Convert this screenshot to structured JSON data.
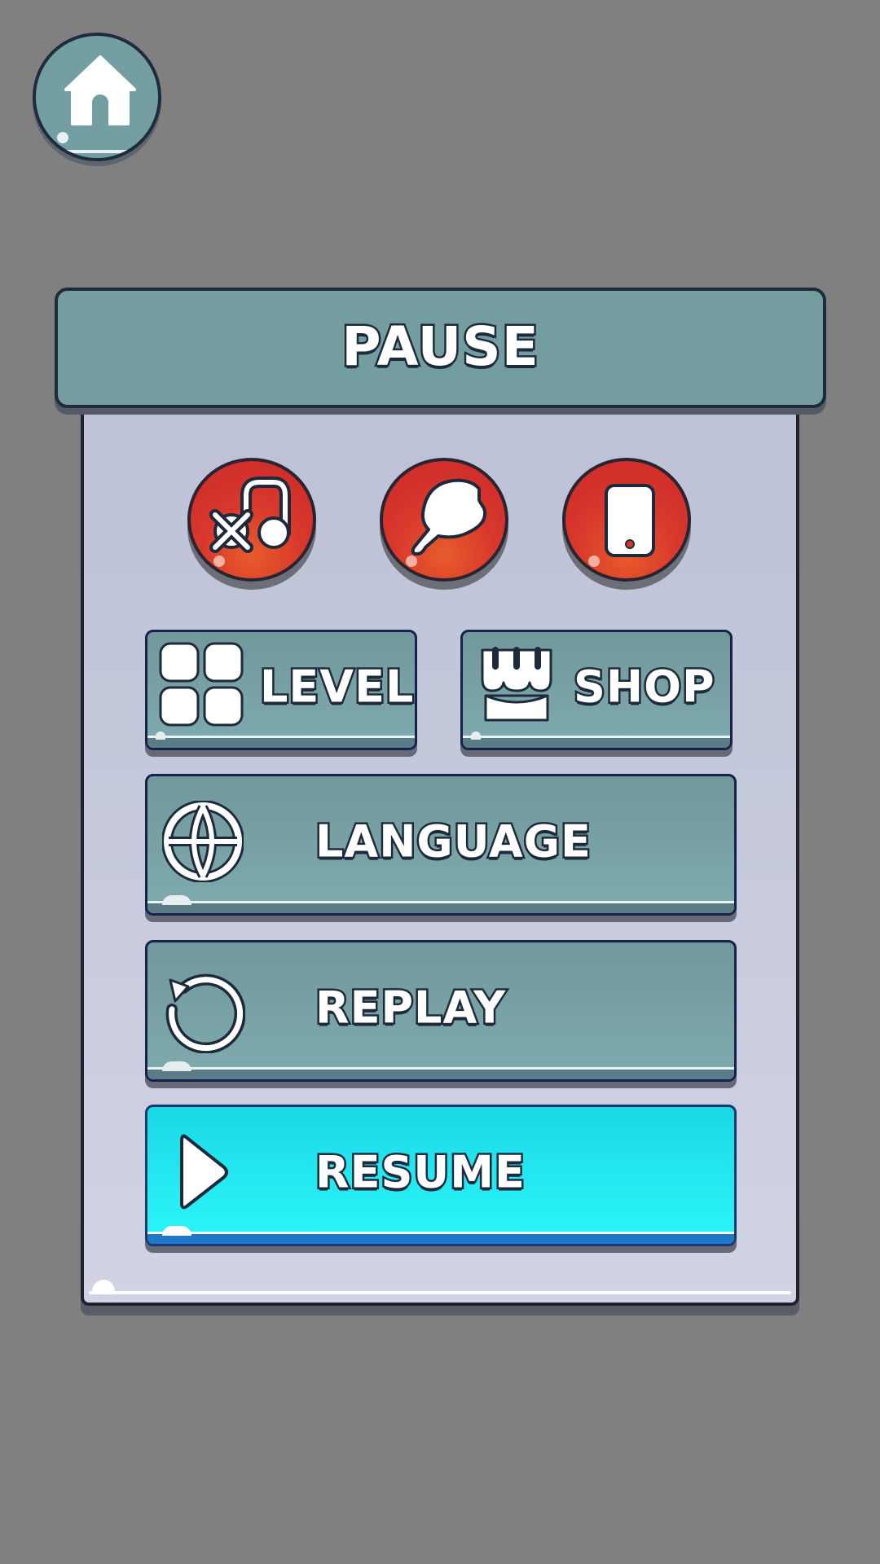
{
  "home": {
    "icon": "home-icon"
  },
  "panel": {
    "title": "PAUSE"
  },
  "toggles": [
    {
      "name": "music-off-toggle",
      "icon": "music-muted-icon"
    },
    {
      "name": "sound-off-toggle",
      "icon": "speaker-muted-icon"
    },
    {
      "name": "vibration-toggle",
      "icon": "phone-icon"
    }
  ],
  "buttons": {
    "level": {
      "label": "LEVEL",
      "icon": "grid-icon"
    },
    "shop": {
      "label": "SHOP",
      "icon": "shop-icon"
    },
    "language": {
      "label": "LANGUAGE",
      "icon": "globe-icon"
    },
    "replay": {
      "label": "REPLAY",
      "icon": "replay-icon"
    },
    "resume": {
      "label": "RESUME",
      "icon": "play-icon"
    }
  },
  "colors": {
    "background": "#808080",
    "teal": "#749da0",
    "red": "#d8382c",
    "cyan": "#2cf6fa",
    "panel": "#c4c8db"
  }
}
